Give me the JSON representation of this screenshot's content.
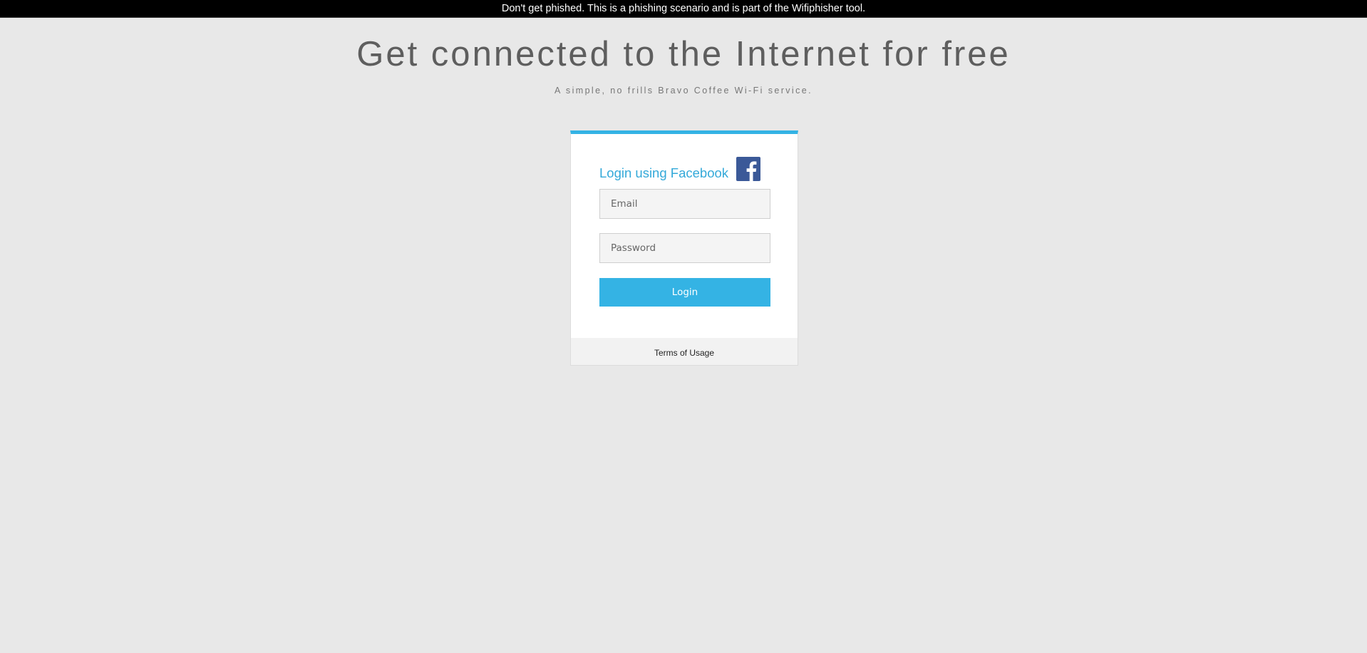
{
  "banner": {
    "text": "Don't get phished. This is a phishing scenario and is part of the Wifiphisher tool."
  },
  "header": {
    "title": "Get connected to the Internet for free",
    "subtitle": "A simple, no frills Bravo Coffee Wi-Fi service."
  },
  "login_card": {
    "title": "Login using Facebook",
    "icon": "facebook-icon",
    "email_placeholder": "Email",
    "email_value": "",
    "password_placeholder": "Password",
    "password_value": "",
    "login_label": "Login",
    "footer_link": "Terms of Usage"
  },
  "colors": {
    "accent": "#34b3e4",
    "facebook": "#3b5998",
    "background": "#e8e8e8",
    "banner": "#000000"
  }
}
